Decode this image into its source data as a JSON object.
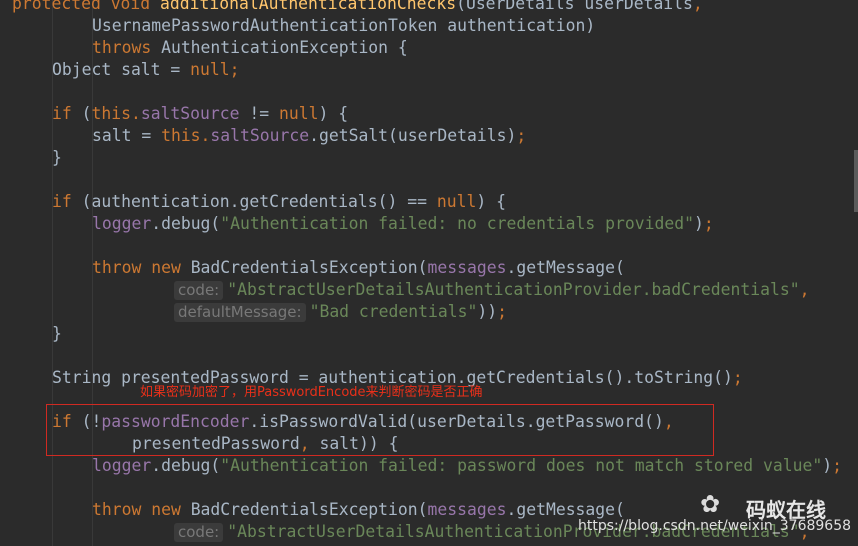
{
  "editor": {
    "lines": [
      {
        "indent": 12,
        "tokens": [
          {
            "t": "protected ",
            "c": "kw"
          },
          {
            "t": "void ",
            "c": "kw"
          },
          {
            "t": "additionalAuthenticationChecks",
            "c": "mth"
          },
          {
            "t": "(UserDetails userDetails",
            "c": ""
          },
          {
            "t": ",",
            "c": "kw"
          }
        ]
      },
      {
        "indent": 92,
        "tokens": [
          {
            "t": "UsernamePasswordAuthenticationToken authentication)",
            "c": ""
          }
        ]
      },
      {
        "indent": 92,
        "tokens": [
          {
            "t": "throws ",
            "c": "kw"
          },
          {
            "t": "AuthenticationException {",
            "c": ""
          }
        ]
      },
      {
        "indent": 52,
        "tokens": [
          {
            "t": "Object salt = ",
            "c": ""
          },
          {
            "t": "null;",
            "c": "kw"
          }
        ]
      },
      {
        "indent": 52,
        "tokens": []
      },
      {
        "indent": 52,
        "tokens": [
          {
            "t": "if ",
            "c": "kw"
          },
          {
            "t": "(",
            "c": ""
          },
          {
            "t": "this.",
            "c": "kw"
          },
          {
            "t": "saltSource",
            "c": "fld"
          },
          {
            "t": " != ",
            "c": ""
          },
          {
            "t": "null",
            "c": "kw"
          },
          {
            "t": ") {",
            "c": ""
          }
        ]
      },
      {
        "indent": 92,
        "tokens": [
          {
            "t": "salt = ",
            "c": ""
          },
          {
            "t": "this.",
            "c": "kw"
          },
          {
            "t": "saltSource",
            "c": "fld"
          },
          {
            "t": ".getSalt(userDetails)",
            "c": ""
          },
          {
            "t": ";",
            "c": "kw"
          }
        ]
      },
      {
        "indent": 52,
        "tokens": [
          {
            "t": "}",
            "c": ""
          }
        ]
      },
      {
        "indent": 52,
        "tokens": []
      },
      {
        "indent": 52,
        "tokens": [
          {
            "t": "if ",
            "c": "kw"
          },
          {
            "t": "(authentication.getCredentials() == ",
            "c": ""
          },
          {
            "t": "null",
            "c": "kw"
          },
          {
            "t": ") {",
            "c": ""
          }
        ]
      },
      {
        "indent": 92,
        "tokens": [
          {
            "t": "logger",
            "c": "fld"
          },
          {
            "t": ".debug(",
            "c": ""
          },
          {
            "t": "\"Authentication failed: no credentials provided\"",
            "c": "str"
          },
          {
            "t": ")",
            "c": ""
          },
          {
            "t": ";",
            "c": "kw"
          }
        ]
      },
      {
        "indent": 92,
        "tokens": []
      },
      {
        "indent": 92,
        "tokens": [
          {
            "t": "throw new ",
            "c": "kw"
          },
          {
            "t": "BadCredentialsException(",
            "c": ""
          },
          {
            "t": "messages",
            "c": "fld"
          },
          {
            "t": ".getMessage(",
            "c": ""
          }
        ]
      },
      {
        "indent": 174,
        "tokens": [
          {
            "hint": "code:"
          },
          {
            "t": "\"AbstractUserDetailsAuthenticationProvider.badCredentials\"",
            "c": "str"
          },
          {
            "t": ",",
            "c": "kw"
          }
        ]
      },
      {
        "indent": 174,
        "tokens": [
          {
            "hint": "defaultMessage:"
          },
          {
            "t": "\"Bad credentials\"",
            "c": "str"
          },
          {
            "t": "))",
            "c": ""
          },
          {
            "t": ";",
            "c": "kw"
          }
        ]
      },
      {
        "indent": 52,
        "tokens": [
          {
            "t": "}",
            "c": ""
          }
        ]
      },
      {
        "indent": 52,
        "tokens": []
      },
      {
        "indent": 52,
        "tokens": [
          {
            "t": "String presentedPassword = authentication.getCredentials().toString()",
            "c": ""
          },
          {
            "t": ";",
            "c": "kw"
          }
        ]
      },
      {
        "indent": 52,
        "tokens": []
      },
      {
        "indent": 52,
        "tokens": [
          {
            "t": "if ",
            "c": "kw"
          },
          {
            "t": "(!",
            "c": ""
          },
          {
            "t": "passwordEncoder",
            "c": "fld"
          },
          {
            "t": ".isPasswordValid(userDetails.getPassword()",
            "c": ""
          },
          {
            "t": ",",
            "c": "kw"
          }
        ]
      },
      {
        "indent": 132,
        "tokens": [
          {
            "t": "presentedPassword",
            "c": ""
          },
          {
            "t": ", ",
            "c": "kw"
          },
          {
            "t": "salt)) {",
            "c": ""
          }
        ]
      },
      {
        "indent": 92,
        "tokens": [
          {
            "t": "logger",
            "c": "fld"
          },
          {
            "t": ".debug(",
            "c": ""
          },
          {
            "t": "\"Authentication failed: password does not match stored value\"",
            "c": "str"
          },
          {
            "t": ")",
            "c": ""
          },
          {
            "t": ";",
            "c": "kw"
          }
        ]
      },
      {
        "indent": 92,
        "tokens": []
      },
      {
        "indent": 92,
        "tokens": [
          {
            "t": "throw new ",
            "c": "kw"
          },
          {
            "t": "BadCredentialsException(",
            "c": ""
          },
          {
            "t": "messages",
            "c": "fld"
          },
          {
            "t": ".getMessage(",
            "c": ""
          }
        ]
      },
      {
        "indent": 174,
        "tokens": [
          {
            "hint": "code:"
          },
          {
            "t": "\"AbstractUserDetailsAuthenticationProvider.badCredentials\"",
            "c": "str"
          },
          {
            "t": ",",
            "c": "kw"
          }
        ]
      }
    ]
  },
  "annotation": {
    "text": "如果密码加密了，用PasswordEncode来判断密码是否正确"
  },
  "watermark": {
    "logo_glyph": "✿",
    "name": "码蚁在线",
    "url": "https://blog.csdn.net/weixin_37689658"
  },
  "colors": {
    "background": "#2b2b2b",
    "keyword": "#cc7832",
    "field": "#9876aa",
    "method": "#ffc66d",
    "string": "#6a8759",
    "text": "#a9b7c6",
    "annotation": "#e8301a"
  }
}
